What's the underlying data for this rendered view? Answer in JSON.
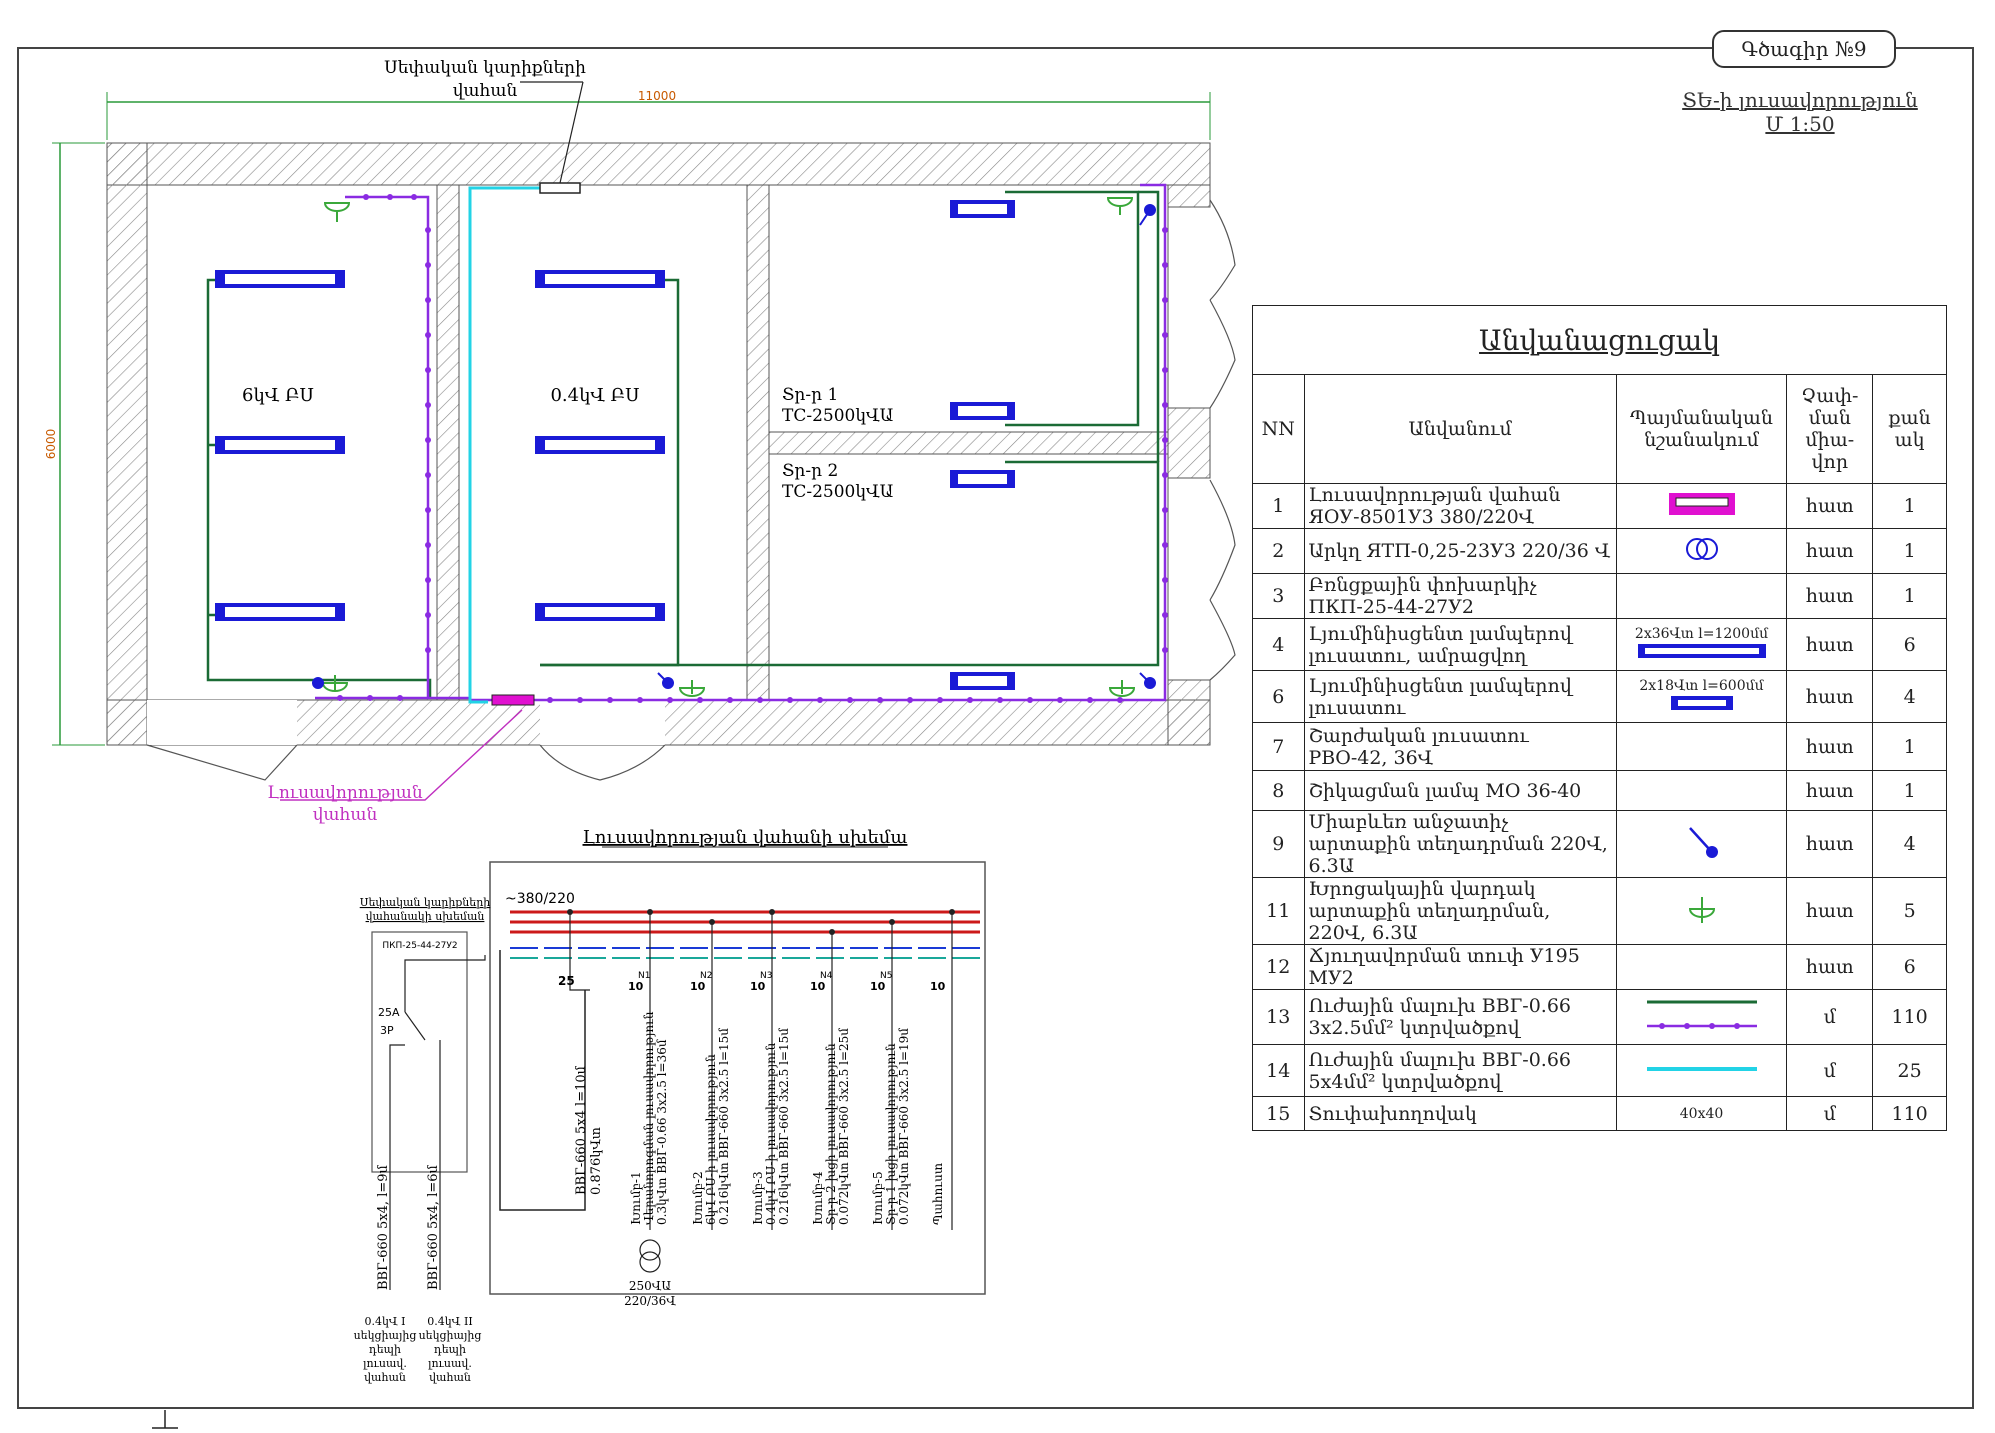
{
  "sheet": {
    "title": "Գծագիր №9",
    "subtitle_line1": "ՏԵ-ի լուսավորություն",
    "subtitle_line2": "Մ 1:50"
  },
  "plan": {
    "dim_width": "11000",
    "dim_height": "6000",
    "label_special_panel_line1": "Սեփական կարիքների",
    "label_special_panel_line2": "վահան",
    "label_lighting_panel_line1": "Լուսավորության",
    "label_lighting_panel_line2": "վահան",
    "room1_label": "6կՎ ԲՍ",
    "room2_label": "0.4կՎ ԲՍ",
    "tr1_line1": "Տր-ր 1",
    "tr1_line2": "ТС-2500կՎԱ",
    "tr2_line1": "Տր-ր 2",
    "tr2_line2": "ТС-2500կՎԱ"
  },
  "schematic": {
    "title": "Լուսավորության վահանի սխեմա",
    "voltage": "~380/220",
    "left_title_line1": "Սեփական կարիքների",
    "left_title_line2": "վահանակի սխեման",
    "switch_model": "ПКП-25-44-27У2",
    "switch_rating": "25А",
    "switch_poles": "3Р",
    "main_breaker": "25",
    "feeder_main_line1": "ВВГ-660 5х4 l=10մ",
    "feeder_main_line2": "0.876կՎտ",
    "cable_left1": "ВВГ-660 5х4, l=9մ",
    "cable_left2": "ВВГ-660 5х4, l=6մ",
    "source1": [
      "0.4կՎ I",
      "սեկցիայից",
      "դեպի",
      "լուսավ.",
      "վահան"
    ],
    "source2": [
      "0.4կՎ II",
      "սեկցիայից",
      "դեպի",
      "լուսավ.",
      "վահան"
    ],
    "transformer_label1": "250ՎԱ",
    "transformer_label2": "220/36Վ",
    "groups": [
      {
        "no": "N1",
        "rating": "10",
        "lines": [
          "Խումբ-1",
          "Վերանորոգման լուսավորություն",
          "0.3կՎտ ВВГ-0.66 3х2.5 l=36մ"
        ]
      },
      {
        "no": "N2",
        "rating": "10",
        "lines": [
          "Խումբ-2",
          "6կՎ ԲՍ-ի լուսավորություն",
          "0.216կՎտ ВВГ-660 3х2.5 l=15մ"
        ]
      },
      {
        "no": "N3",
        "rating": "10",
        "lines": [
          "Խումբ-3",
          "0.4կՎ ԲՍ-ի լուսավորություն",
          "0.216կՎտ ВВГ-660 3х2.5 l=15մ"
        ]
      },
      {
        "no": "N4",
        "rating": "10",
        "lines": [
          "Խումբ-4",
          "Տր-ր 2 խցի լուսավորություն",
          "0.072կՎտ ВВГ-660 3х2.5 l=25մ"
        ]
      },
      {
        "no": "N5",
        "rating": "10",
        "lines": [
          "Խումբ-5",
          "Տր-ր 1 խցի լուսավորություն",
          "0.072կՎտ ВВГ-660 3х2.5 l=19մ"
        ]
      },
      {
        "no": "",
        "rating": "10",
        "lines": [
          "Պահուստ",
          "",
          ""
        ]
      }
    ]
  },
  "legend": {
    "caption": "Անվանացուցակ",
    "headers": {
      "nn": "NN",
      "name": "Անվանում",
      "symbol": "Պայմանական նշանակում",
      "unit": "Չափ-ման միա-վոր",
      "qty": "քան ակ"
    },
    "rows": [
      {
        "nn": "1",
        "name": "Լուսավորության վահան ЯОУ-8501У3 380/220Վ",
        "symbol": "",
        "unit": "հատ",
        "qty": "1"
      },
      {
        "nn": "2",
        "name": "Արկղ  ЯТП-0,25-23У3 220/36 Վ",
        "symbol": "",
        "unit": "հատ",
        "qty": "1"
      },
      {
        "nn": "3",
        "name": "Բռնցքային փոխարկիչ ПКП-25-44-27У2",
        "symbol": "",
        "unit": "հատ",
        "qty": "1"
      },
      {
        "nn": "4",
        "name": "Լյումինիսցենտ լամպերով լուսատու,  ամրացվող",
        "symbol": "2x36Վտ l=1200մմ",
        "unit": "հատ",
        "qty": "6"
      },
      {
        "nn": "6",
        "name": "Լյումինիսցենտ լամպերով լուսատու",
        "symbol": "2x18Վտ l=600մմ",
        "unit": "հատ",
        "qty": "4"
      },
      {
        "nn": "7",
        "name": "Շարժական լուսատու  РВО-42, 36Վ",
        "symbol": "",
        "unit": "հատ",
        "qty": "1"
      },
      {
        "nn": "8",
        "name": "Շիկացման լամպ  МО 36-40",
        "symbol": "",
        "unit": "հատ",
        "qty": "1"
      },
      {
        "nn": "9",
        "name": "Միաբևեռ անջատիչ արտաքին տեղադրման  220Վ, 6.3Ա",
        "symbol": "",
        "unit": "հատ",
        "qty": "4"
      },
      {
        "nn": "11",
        "name": "Խրոցակային վարդակ արտաքին տեղադրման, 220Վ, 6.3Ա",
        "symbol": "",
        "unit": "հատ",
        "qty": "5"
      },
      {
        "nn": "12",
        "name": "Ճյուղավորման տուփ У195 МУ2",
        "symbol": "",
        "unit": "հատ",
        "qty": "6"
      },
      {
        "nn": "13",
        "name": "Ուժային մալուխ ВВГ-0.66 3х2.5մմ² կտրվածքով",
        "symbol": "",
        "unit": "մ",
        "qty": "110"
      },
      {
        "nn": "14",
        "name": "Ուժային մալուխ ВВГ-0.66 5х4մմ² կտրվածքով",
        "symbol": "",
        "unit": "մ",
        "qty": "25"
      },
      {
        "nn": "15",
        "name": "Տուփախողովակ",
        "symbol": "40x40",
        "unit": "մ",
        "qty": "110"
      }
    ]
  },
  "colors": {
    "cable_green": "#1b6b35",
    "cable_purple": "#8a2be2",
    "cable_cyan": "#22d3e6",
    "luminaire_blue": "#1a1ad6",
    "panel_magenta": "#e010d0",
    "socket_green": "#3aa83a",
    "bus_red": "#cc1a1a",
    "bus_blue": "#1a3ad6",
    "bus_teal": "#1aa89a"
  }
}
